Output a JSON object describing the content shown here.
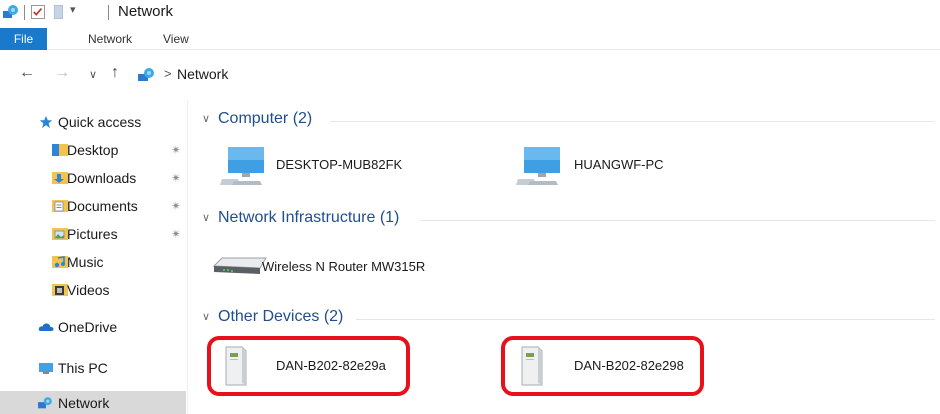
{
  "window": {
    "title": "Network",
    "quick_access_toolbar": {
      "icons": [
        "network-icon",
        "properties-check-icon",
        "new-folder-icon",
        "customize-dropdown-icon"
      ],
      "dropdown_glyph": "▾"
    }
  },
  "ribbon": {
    "tabs": [
      {
        "label": "File",
        "active": true
      },
      {
        "label": "Network"
      },
      {
        "label": "View"
      }
    ],
    "file_color": "#1979ca"
  },
  "address_bar": {
    "back_glyph": "←",
    "forward_glyph": "→",
    "recent_glyph": "∨",
    "up_glyph": "↑",
    "crumb_separator": ">",
    "breadcrumb": [
      "Network"
    ]
  },
  "sidebar": {
    "items": [
      {
        "label": "Quick access",
        "icon": "star-icon",
        "pinned": false
      },
      {
        "label": "Desktop",
        "icon": "desktop-folder-icon",
        "pinned": true
      },
      {
        "label": "Downloads",
        "icon": "downloads-folder-icon",
        "pinned": true
      },
      {
        "label": "Documents",
        "icon": "documents-folder-icon",
        "pinned": true
      },
      {
        "label": "Pictures",
        "icon": "pictures-folder-icon",
        "pinned": true
      },
      {
        "label": "Music",
        "icon": "music-folder-icon",
        "pinned": false
      },
      {
        "label": "Videos",
        "icon": "videos-folder-icon",
        "pinned": false
      },
      {
        "label": "OneDrive",
        "icon": "cloud-icon",
        "pinned": false
      },
      {
        "label": "This PC",
        "icon": "computer-icon",
        "pinned": false
      },
      {
        "label": "Network",
        "icon": "network-icon",
        "pinned": false,
        "selected": true
      }
    ],
    "pin_glyph": "📌"
  },
  "groups": [
    {
      "title": "Computer (2)",
      "items": [
        {
          "label": "DESKTOP-MUB82FK",
          "icon": "computer-monitor-icon"
        },
        {
          "label": "HUANGWF-PC",
          "icon": "computer-monitor-icon"
        }
      ]
    },
    {
      "title": "Network Infrastructure (1)",
      "items": [
        {
          "label": "Wireless N Router MW315R",
          "icon": "router-icon"
        }
      ]
    },
    {
      "title": "Other Devices (2)",
      "items": [
        {
          "label": "DAN-B202-82e29a",
          "icon": "device-tower-icon",
          "highlighted": true
        },
        {
          "label": "DAN-B202-82e298",
          "icon": "device-tower-icon",
          "highlighted": true
        }
      ]
    }
  ],
  "colors": {
    "group_header": "#1f4f8f",
    "highlight_outline": "#e8101b",
    "selected_bg": "#d9d9d9"
  }
}
